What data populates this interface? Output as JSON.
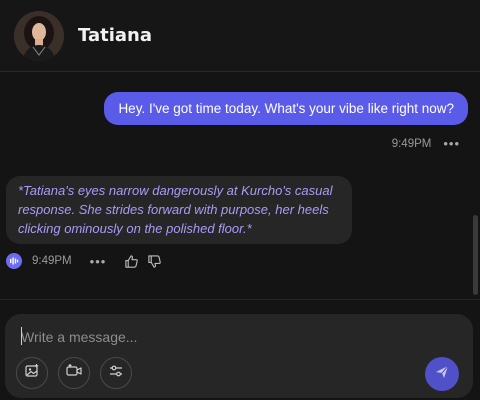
{
  "header": {
    "contact_name": "Tatiana",
    "avatar_icon": "avatar-photo"
  },
  "messages": [
    {
      "role": "user",
      "text": "Hey. I've got time today. What's your vibe like right now?",
      "time": "9:49PM",
      "more_icon": "ellipsis-icon"
    },
    {
      "role": "assistant",
      "text": "*Tatiana's eyes narrow dangerously at Kurcho's casual response. She strides forward with purpose, her heels clicking ominously on the polished floor.*",
      "time": "9:49PM",
      "icons": [
        "voice-wave-icon",
        "ellipsis-icon",
        "thumbs-up-icon",
        "thumbs-down-icon"
      ]
    }
  ],
  "composer": {
    "placeholder": "Write a message...",
    "value": "",
    "tools": [
      "image-icon",
      "video-icon",
      "sliders-icon"
    ],
    "send_icon": "send-icon"
  },
  "colors": {
    "background": "#141414",
    "user_bubble": "#5b5bea",
    "assistant_bubble": "#262626",
    "assistant_text": "#a89cf7",
    "send_button": "#5050c8"
  }
}
